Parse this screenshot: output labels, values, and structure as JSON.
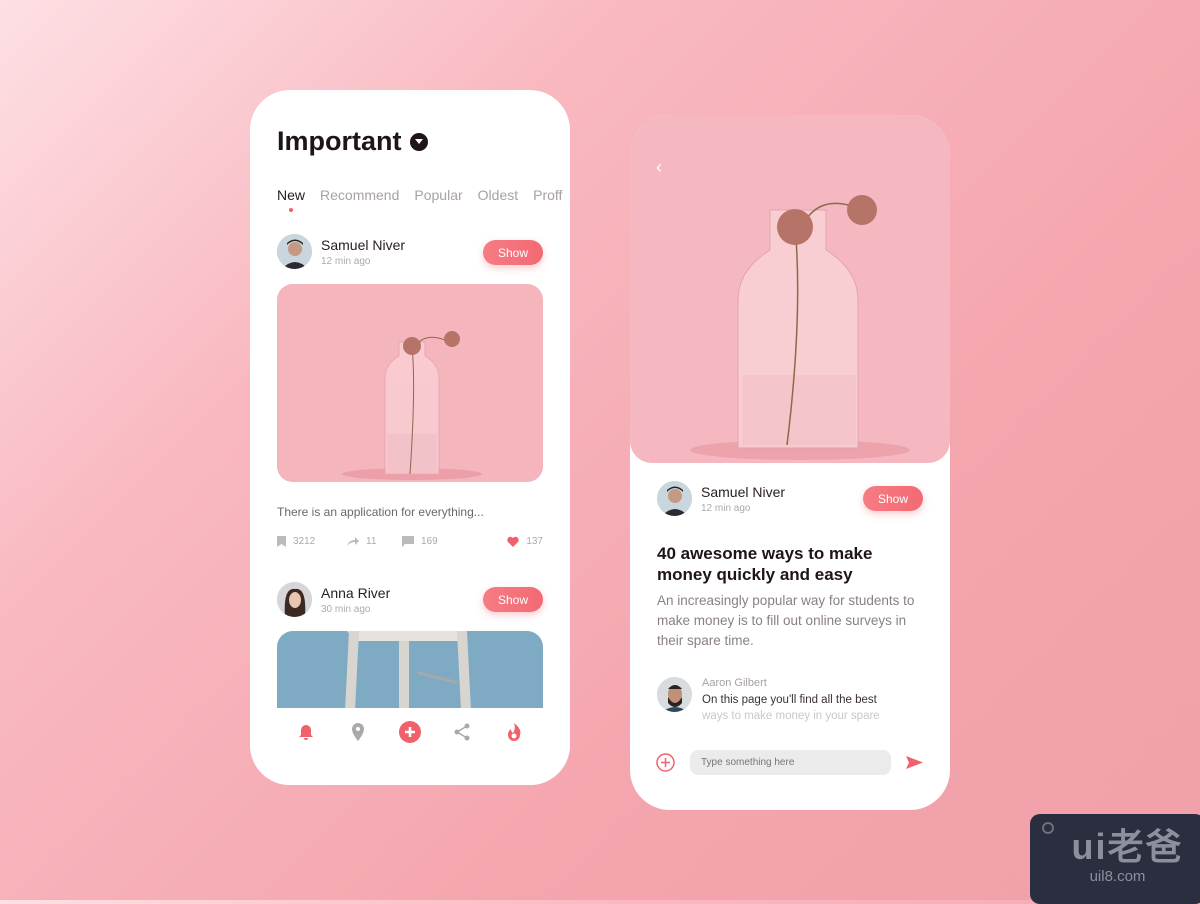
{
  "feed": {
    "title": "Important",
    "tabs": [
      "New",
      "Recommend",
      "Popular",
      "Oldest",
      "Proff"
    ],
    "active_tab": "New",
    "posts": [
      {
        "author": "Samuel Niver",
        "time": "12 min ago",
        "show_label": "Show",
        "caption": "There is an application for everything...",
        "stats": {
          "bookmarks": "3212",
          "shares": "11",
          "comments": "169",
          "likes": "137"
        }
      },
      {
        "author": "Anna River",
        "time": "30 min ago",
        "show_label": "Show"
      }
    ],
    "nav_icons": [
      "bell-icon",
      "location-pin-icon",
      "add-icon",
      "share-icon",
      "fire-icon"
    ]
  },
  "detail": {
    "author": "Samuel Niver",
    "time": "12 min ago",
    "show_label": "Show",
    "headline": "40 awesome ways to make money quickly and easy",
    "description": "An increasingly popular way for students to make money is to fill out online surveys in their spare time.",
    "comment": {
      "author": "Aaron Gilbert",
      "text": "On this page you'll find all the best",
      "text_faded": "ways to make money in your spare"
    },
    "input_placeholder": "Type something here"
  },
  "watermark": {
    "logo": "ui老爸",
    "url": "uil8.com"
  },
  "colors": {
    "accent": "#f26a74",
    "background": "#f4a4ad"
  }
}
